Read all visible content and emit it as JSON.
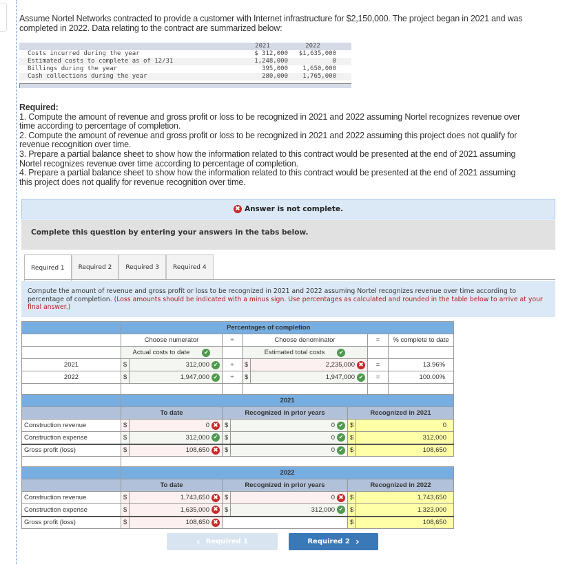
{
  "problem": {
    "intro": "Assume Nortel Networks contracted to provide a customer with Internet infrastructure for $2,150,000. The project began in 2021 and was completed in 2022. Data relating to the contract are summarized below:",
    "data_table": {
      "headers": [
        "",
        "2021",
        "2022"
      ],
      "rows": [
        {
          "label": "Costs incurred during the year",
          "y2021": "$  312,000",
          "y2022": "$1,635,000"
        },
        {
          "label": "Estimated costs to complete as of 12/31",
          "y2021": "1,248,000",
          "y2022": "0"
        },
        {
          "label": "Billings during the year",
          "y2021": "395,000",
          "y2022": "1,650,000"
        },
        {
          "label": "Cash collections during the year",
          "y2021": "280,000",
          "y2022": "1,765,000"
        }
      ]
    },
    "required_heading": "Required:",
    "required_items": [
      "1. Compute the amount of revenue and gross profit or loss to be recognized in 2021 and 2022 assuming Nortel recognizes revenue over time according to percentage of completion.",
      "2. Compute the amount of revenue and gross profit or loss to be recognized in 2021 and 2022 assuming this project does not qualify for revenue recognition over time.",
      "3. Prepare a partial balance sheet to show how the information related to this contract would be presented at the end of 2021 assuming Nortel recognizes revenue over time according to percentage of completion.",
      "4. Prepare a partial balance sheet to show how the information related to this contract would be presented at the end of 2021 assuming this project does not qualify for revenue recognition over time."
    ]
  },
  "status": {
    "icon": "error-icon",
    "message": "Answer is not complete."
  },
  "instructions": "Complete this question by entering your answers in the tabs below.",
  "tabs": [
    {
      "label": "Required 1",
      "active": true
    },
    {
      "label": "Required 2",
      "active": false
    },
    {
      "label": "Required 3",
      "active": false
    },
    {
      "label": "Required 4",
      "active": false
    }
  ],
  "question": {
    "text": "Compute the amount of revenue and gross profit or loss to be recognized in 2021 and 2022 assuming Nortel recognizes revenue over time according to percentage of completion.",
    "note": "(Loss amounts should be indicated with a minus sign. Use percentages as calculated and rounded in the table below to arrive at your final answer.)"
  },
  "percent_table": {
    "title": "Percentages of completion",
    "numerator_header": "Choose numerator",
    "divide": "÷",
    "denominator_header": "Choose denominator",
    "equals": "=",
    "result_header": "% complete to date",
    "numerator_choice": "Actual costs to date",
    "numerator_choice_status": "correct",
    "denominator_choice": "Estimated total costs",
    "denominator_choice_status": "correct",
    "currency": "$",
    "rows": [
      {
        "year": "2021",
        "numerator": "312,000",
        "numerator_status": "correct",
        "denominator": "2,235,000",
        "denominator_status": "incorrect",
        "result": "13.96%"
      },
      {
        "year": "2022",
        "numerator": "1,947,000",
        "numerator_status": "correct",
        "denominator": "1,947,000",
        "denominator_status": "correct",
        "result": "100.00%"
      }
    ]
  },
  "year_tables": [
    {
      "year": "2021",
      "col_to_date": "To date",
      "col_prior": "Recognized in prior years",
      "col_current": "Recognized in 2021",
      "currency": "$",
      "rows": [
        {
          "label": "Construction revenue",
          "to_date": "0",
          "to_date_status": "incorrect",
          "prior": "0",
          "prior_status": "correct",
          "current": "0"
        },
        {
          "label": "Construction expense",
          "to_date": "312,000",
          "to_date_status": "correct",
          "prior": "0",
          "prior_status": "correct",
          "current": "312,000"
        },
        {
          "label": "Gross profit (loss)",
          "to_date": "108,650",
          "to_date_status": "incorrect",
          "prior": "0",
          "prior_status": "correct",
          "current": "108,650"
        }
      ]
    },
    {
      "year": "2022",
      "col_to_date": "To date",
      "col_prior": "Recognized in prior years",
      "col_current": "Recognized in 2022",
      "currency": "$",
      "rows": [
        {
          "label": "Construction revenue",
          "to_date": "1,743,650",
          "to_date_status": "incorrect",
          "prior": "0",
          "prior_status": "incorrect",
          "current": "1,743,650"
        },
        {
          "label": "Construction expense",
          "to_date": "1,635,000",
          "to_date_status": "incorrect",
          "prior": "312,000",
          "prior_status": "correct",
          "current": "1,323,000"
        },
        {
          "label": "Gross profit (loss)",
          "to_date": "108,650",
          "to_date_status": "incorrect",
          "prior": "",
          "prior_status": "",
          "current": "108,650"
        }
      ]
    }
  ],
  "navigation": {
    "prev_label": "Required 1",
    "prev_icon": "chevron-left-icon",
    "next_label": "Required 2",
    "next_icon": "chevron-right-icon"
  },
  "glyphs": {
    "check": "✔",
    "cross": "✖",
    "chev_left": "‹",
    "chev_right": "›"
  }
}
